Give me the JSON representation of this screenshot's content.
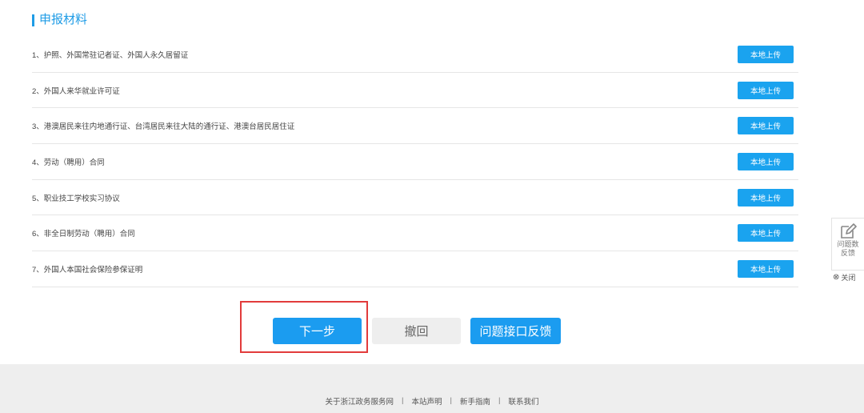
{
  "section": {
    "title": "申报材料"
  },
  "materials": [
    {
      "label": "1、护照、外国常驻记者证、外国人永久居留证",
      "button": "本地上传"
    },
    {
      "label": "2、外国人来华就业许可证",
      "button": "本地上传"
    },
    {
      "label": "3、港澳居民来往内地通行证、台湾居民来往大陆的通行证、港澳台居民居住证",
      "button": "本地上传"
    },
    {
      "label": "4、劳动（聘用）合同",
      "button": "本地上传"
    },
    {
      "label": "5、职业技工学校实习协议",
      "button": "本地上传"
    },
    {
      "label": "6、非全日制劳动（聘用）合同",
      "button": "本地上传"
    },
    {
      "label": "7、外国人本国社会保险参保证明",
      "button": "本地上传"
    }
  ],
  "actions": {
    "next": "下一步",
    "revoke": "撤回",
    "feedback": "问题接口反馈"
  },
  "footer": {
    "links": [
      "关于浙江政务服务网",
      "本站声明",
      "新手指南",
      "联系我们"
    ],
    "separator": "|"
  },
  "float_widget": {
    "line1": "问题数",
    "line2": "反馈",
    "close": "关闭",
    "icon": "edit-icon"
  },
  "colors": {
    "accent": "#1f9ce6",
    "button": "#1aa3ef",
    "highlight": "#e23b3b"
  }
}
